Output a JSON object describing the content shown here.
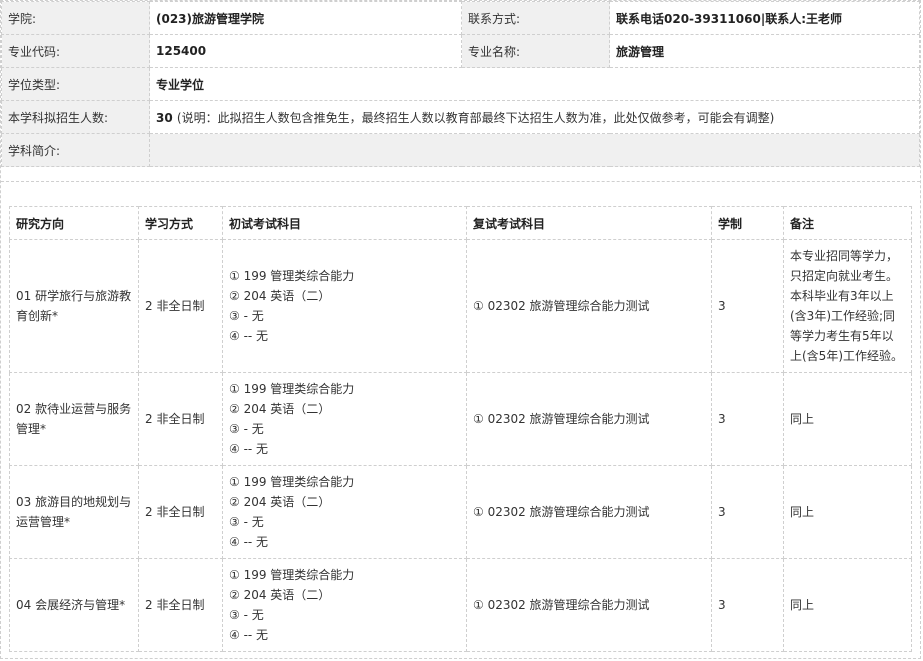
{
  "info": {
    "college_label": "学院:",
    "college_value": "(023)旅游管理学院",
    "contact_label": "联系方式:",
    "contact_value": "联系电话020-39311060|联系人:王老师",
    "code_label": "专业代码:",
    "code_value": "125400",
    "name_label": "专业名称:",
    "name_value": "旅游管理",
    "degree_label": "学位类型:",
    "degree_value": "专业学位",
    "quota_label": "本学科拟招生人数:",
    "quota_value": "30",
    "quota_note": "(说明：此拟招生人数包含推免生，最终招生人数以教育部最终下达招生人数为准，此处仅做参考，可能会有调整)",
    "intro_label": "学科简介:"
  },
  "table": {
    "headers": [
      "研究方向",
      "学习方式",
      "初试考试科目",
      "复试考试科目",
      "学制",
      "备注"
    ],
    "rows": [
      {
        "direction": "01 研学旅行与旅游教育创新*",
        "mode": "2 非全日制",
        "exam": [
          "①  199  管理类综合能力",
          "②  204  英语（二）",
          "③  -  无",
          "④  --  无"
        ],
        "retest": "①  02302  旅游管理综合能力测试",
        "years": "3",
        "remark": "本专业招同等学力，只招定向就业考生。本科毕业有3年以上(含3年)工作经验;同等学力考生有5年以上(含5年)工作经验。"
      },
      {
        "direction": "02 款待业运营与服务管理*",
        "mode": "2 非全日制",
        "exam": [
          "①  199  管理类综合能力",
          "②  204  英语（二）",
          "③  -  无",
          "④  --  无"
        ],
        "retest": "①  02302  旅游管理综合能力测试",
        "years": "3",
        "remark": "同上"
      },
      {
        "direction": "03 旅游目的地规划与运营管理*",
        "mode": "2 非全日制",
        "exam": [
          "①  199  管理类综合能力",
          "②  204  英语（二）",
          "③  -  无",
          "④  --  无"
        ],
        "retest": "①  02302  旅游管理综合能力测试",
        "years": "3",
        "remark": "同上"
      },
      {
        "direction": "04 会展经济与管理*",
        "mode": "2 非全日制",
        "exam": [
          "①  199  管理类综合能力",
          "②  204  英语（二）",
          "③  -  无",
          "④  --  无"
        ],
        "retest": "①  02302  旅游管理综合能力测试",
        "years": "3",
        "remark": "同上"
      }
    ]
  }
}
